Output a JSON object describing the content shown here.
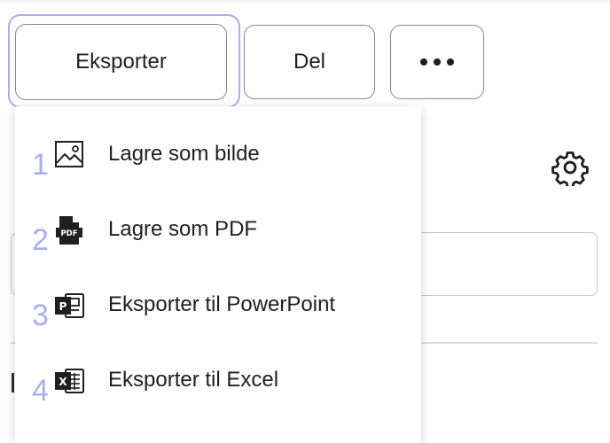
{
  "toolbar": {
    "export_label": "Eksporter",
    "share_label": "Del",
    "more_icon": "more-horizontal-icon"
  },
  "settings": {
    "icon": "gear-icon"
  },
  "export_menu": {
    "items": [
      {
        "number": "1",
        "icon": "image-icon",
        "label": "Lagre som bilde"
      },
      {
        "number": "2",
        "icon": "pdf-file-icon",
        "label": "Lagre som PDF"
      },
      {
        "number": "3",
        "icon": "powerpoint-icon",
        "label": "Eksporter til PowerPoint"
      },
      {
        "number": "4",
        "icon": "excel-icon",
        "label": "Eksporter til Excel"
      }
    ]
  },
  "colors": {
    "focus_ring": "#a8aef0",
    "number_hint": "#a9aef5",
    "text": "#1f1f1f"
  }
}
